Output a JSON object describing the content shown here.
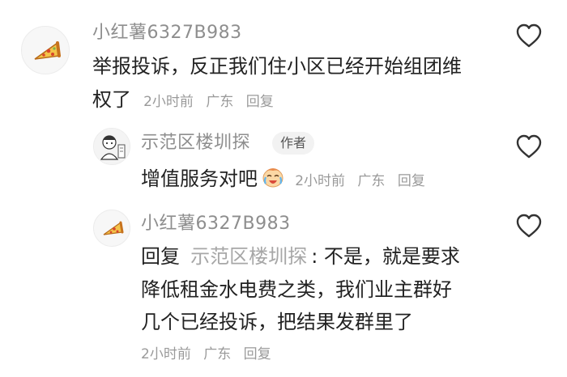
{
  "comments": [
    {
      "username": "小红薯6327B983",
      "avatar": "pizza-slice-icon",
      "lines": [
        "举报投诉，反正我们住小区已经开始组团维",
        "权了"
      ],
      "time": "2小时前",
      "location": "广东",
      "reply_label": "回复"
    },
    {
      "username": "示范区楼圳探",
      "badge": "作者",
      "avatar": "cartoon-person-icon",
      "text": "增值服务对吧",
      "emoji": "crying-laughing-emoji",
      "time": "2小时前",
      "location": "广东",
      "reply_label": "回复"
    },
    {
      "username": "小红薯6327B983",
      "avatar": "pizza-slice-icon",
      "reply_prefix": "回复",
      "mention": "示范区楼圳探",
      "line1_rest": ": 不是，就是要求",
      "lines": [
        "降低租金水电费之类，我们业主群好",
        "几个已经投诉，把结果发群里了"
      ],
      "time": "2小时前",
      "location": "广东",
      "reply_label": "回复"
    }
  ]
}
